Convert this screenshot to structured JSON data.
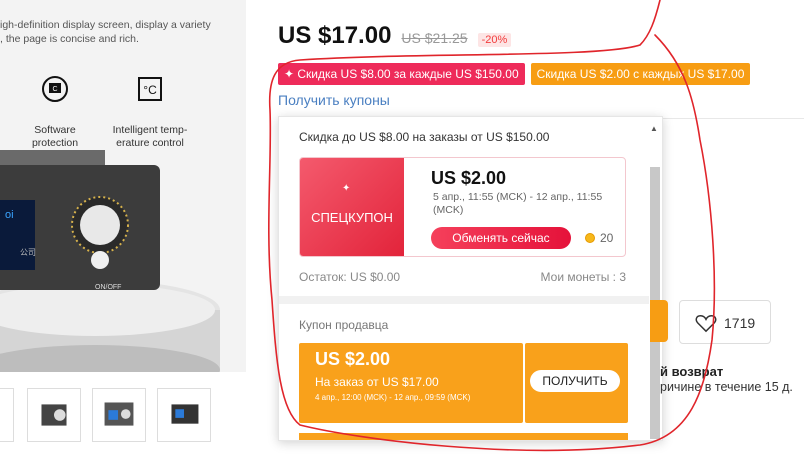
{
  "left": {
    "description": "igh-definition display screen, display a variety\n, the page is concise and rich.",
    "features": [
      {
        "label": "Software\nprotection",
        "icon": "cpu-shield-icon"
      },
      {
        "label": "Intelligent temp-\nerature control",
        "icon": "thermometer-celsius-icon"
      }
    ],
    "device_brand": "oi",
    "device_text": "公司",
    "device_switch": "ON/OFF"
  },
  "price": {
    "current": "US $17.00",
    "original": "US $21.25",
    "discount": "-20%"
  },
  "promos": {
    "red": "✦ Скидка US $8.00 за каждые US $150.00",
    "orange": "Скидка US $2.00 с каждых US $17.00"
  },
  "get_coupons": "Получить купоны",
  "panel": {
    "header": "Скидка до US $8.00 на заказы от US $150.00",
    "special": {
      "label": "СПЕЦКУПОН",
      "star": "✦",
      "amount": "US $2.00",
      "dates": "5 апр., 11:55 (MCK) - 12 апр., 11:55 (MCK)",
      "button": "Обменять сейчас",
      "coins": "20"
    },
    "remaining": "Остаток: US $0.00",
    "my_coins": "Мои монеты : 3",
    "seller_title": "Купон продавца",
    "seller": {
      "amount": "US $2.00",
      "condition": "На заказ от US $17.00",
      "dates": "4 апр., 12:00 (MCK) - 12 апр., 09:59 (MCK)",
      "button": "ПОЛУЧИТЬ"
    }
  },
  "right": {
    "wishlist_count": "1719",
    "return_title": "й возврат",
    "return_text": "ричине в течение 15 д."
  },
  "colors": {
    "accent_red": "#ee2b5a",
    "accent_orange": "#f9a11b",
    "link_blue": "#4a7fc1",
    "annotation_red": "#e0252b"
  }
}
